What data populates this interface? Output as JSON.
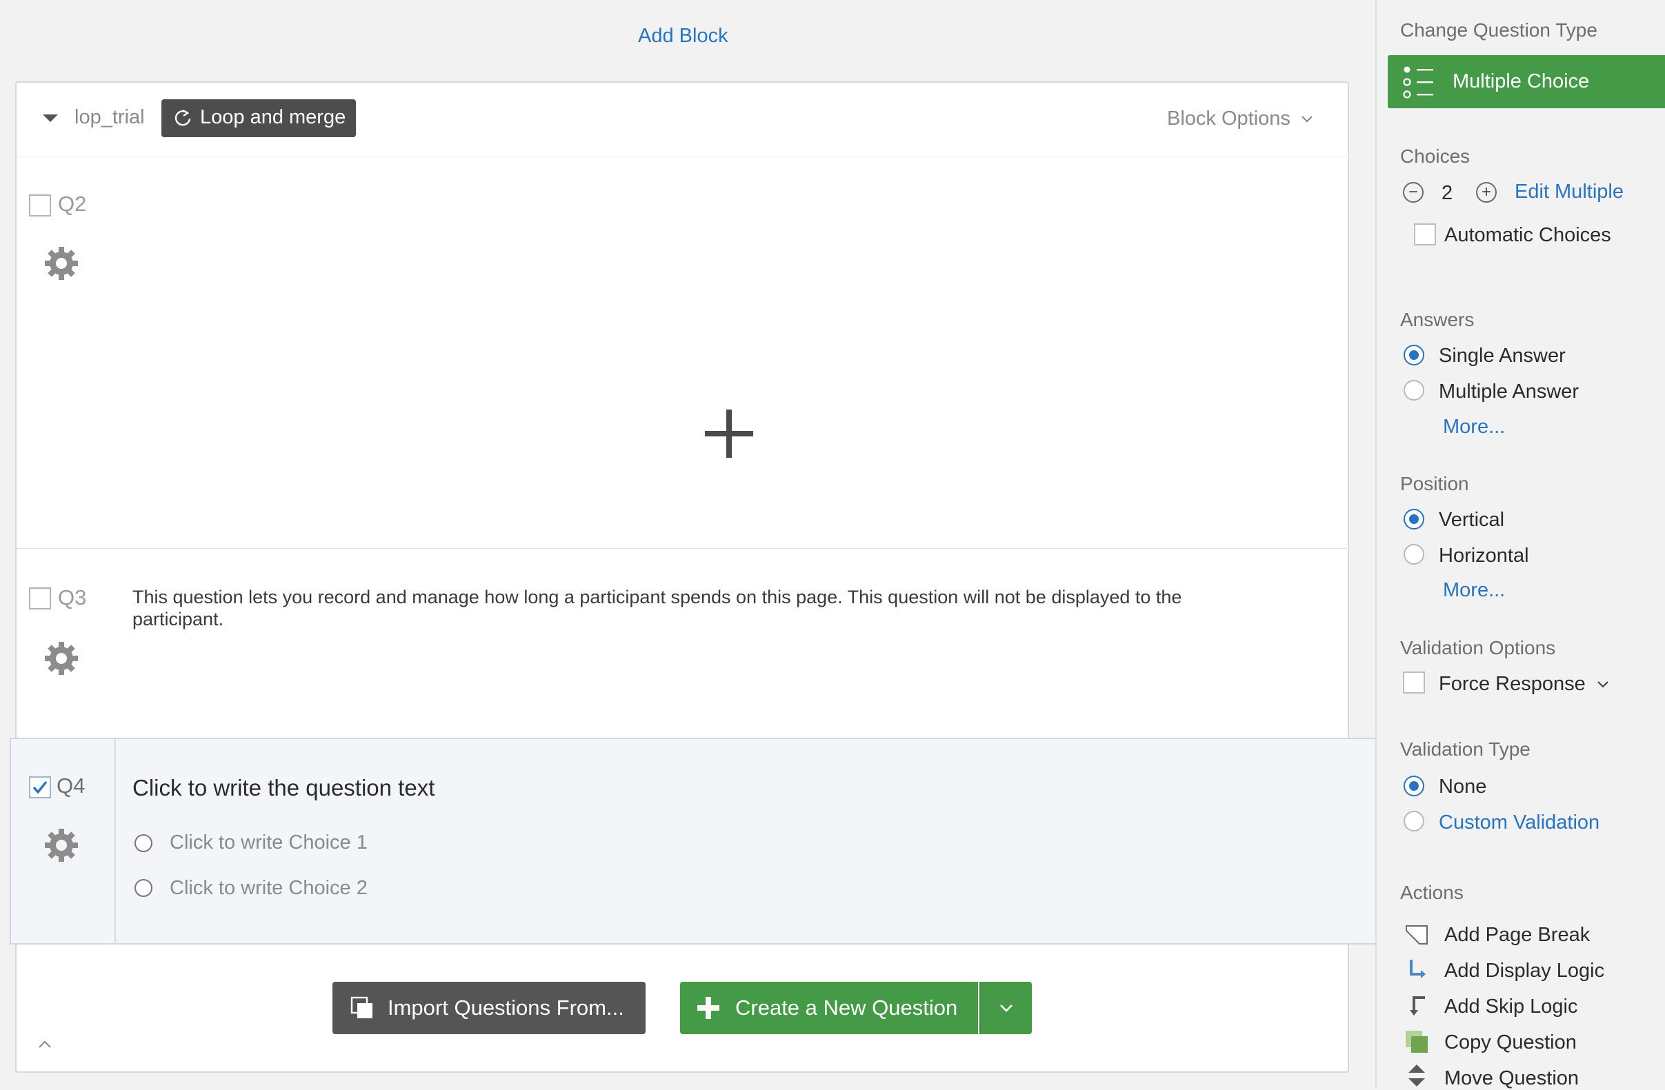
{
  "header": {
    "add_block": "Add Block"
  },
  "block": {
    "name": "lop_trial",
    "loop_label": "Loop and merge",
    "options_label": "Block Options"
  },
  "questions": {
    "q2": {
      "id": "Q2"
    },
    "q3": {
      "id": "Q3",
      "text": "This question lets you record and manage how long a participant spends on this page. This question will not be displayed to the participant."
    },
    "q4": {
      "id": "Q4",
      "text": "Click to write the question text",
      "choices": [
        "Click to write Choice 1",
        "Click to write Choice 2"
      ]
    }
  },
  "footer": {
    "import_label": "Import Questions From...",
    "create_label": "Create a New Question"
  },
  "panel": {
    "change_type_heading": "Change Question Type",
    "question_type": "Multiple Choice",
    "choices_heading": "Choices",
    "choices_count": "2",
    "edit_multiple": "Edit Multiple",
    "automatic_choices": "Automatic Choices",
    "answers_heading": "Answers",
    "single_answer": "Single Answer",
    "multiple_answer": "Multiple Answer",
    "answers_more": "More...",
    "position_heading": "Position",
    "vertical": "Vertical",
    "horizontal": "Horizontal",
    "position_more": "More...",
    "validation_options_heading": "Validation Options",
    "force_response": "Force Response",
    "validation_type_heading": "Validation Type",
    "none": "None",
    "custom_validation": "Custom Validation",
    "actions_heading": "Actions",
    "actions": [
      "Add Page Break",
      "Add Display Logic",
      "Add Skip Logic",
      "Copy Question",
      "Move Question"
    ]
  },
  "colors": {
    "accent": "#2774c2",
    "green": "#459a47",
    "dark": "#4d4d4d"
  }
}
